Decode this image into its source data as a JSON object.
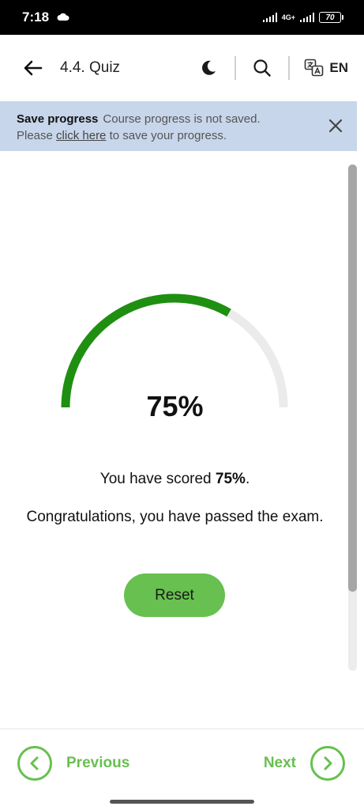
{
  "status_bar": {
    "time": "7:18",
    "network": "4G+",
    "battery": "70"
  },
  "header": {
    "title": "4.4. Quiz",
    "language": "EN"
  },
  "banner": {
    "heading": "Save progress",
    "message": "Course progress is not saved.",
    "prompt_before": "Please",
    "link_text": "click here",
    "prompt_after": "to save your progress."
  },
  "result": {
    "score_display": "75%",
    "score_fraction": 0.75,
    "scored_prefix": "You have scored",
    "scored_value": "75%",
    "scored_suffix": ".",
    "message": "Congratulations, you have passed the exam.",
    "reset_label": "Reset"
  },
  "footer": {
    "previous_label": "Previous",
    "next_label": "Next"
  },
  "colors": {
    "gauge_fill": "#1f8f12",
    "gauge_track": "#ebebeb",
    "accent": "#67c04f",
    "banner_bg": "#c7d6ea"
  }
}
